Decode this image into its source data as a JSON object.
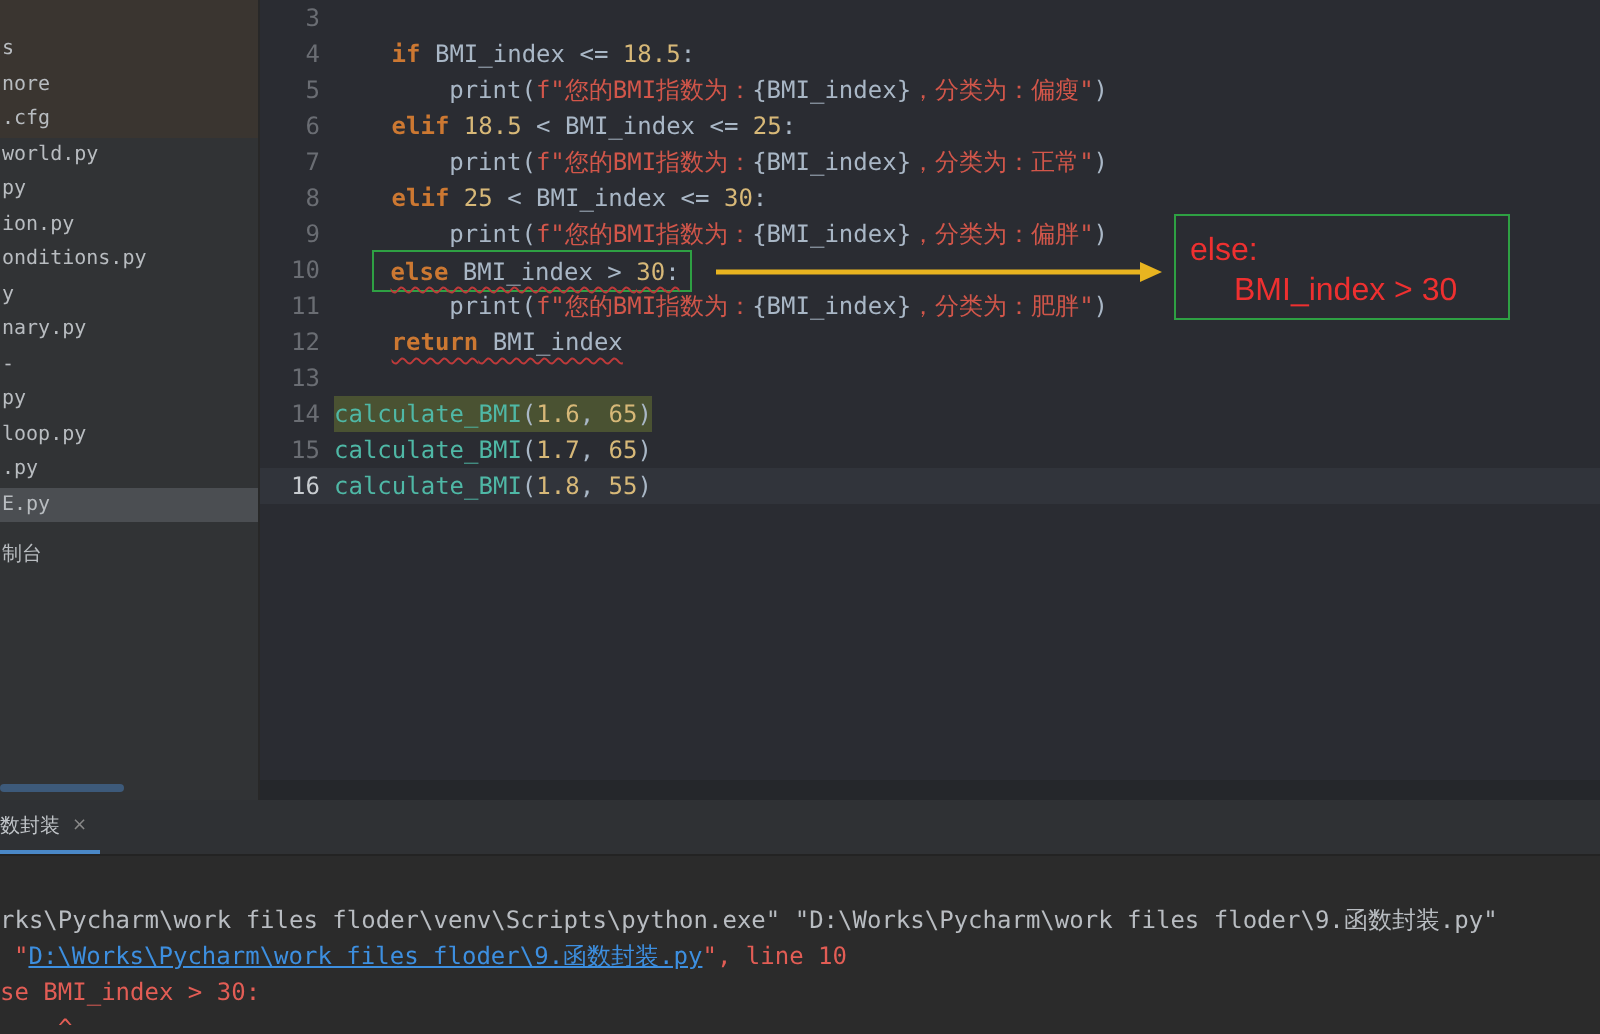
{
  "sidebar": {
    "items": [
      {
        "text": "s",
        "kind": "excluded",
        "selected": false
      },
      {
        "text": "nore",
        "kind": "excluded",
        "selected": false
      },
      {
        "text": ".cfg",
        "kind": "excluded",
        "selected": false
      },
      {
        "text": "world.py",
        "kind": "file",
        "selected": false
      },
      {
        "text": "py",
        "kind": "file",
        "selected": false
      },
      {
        "text": "ion.py",
        "kind": "file",
        "selected": false
      },
      {
        "text": "onditions.py",
        "kind": "file",
        "selected": false
      },
      {
        "text": "y",
        "kind": "file",
        "selected": false
      },
      {
        "text": "nary.py",
        "kind": "file",
        "selected": false
      },
      {
        "text": "-",
        "kind": "file",
        "selected": false
      },
      {
        "text": "py",
        "kind": "file",
        "selected": false
      },
      {
        "text": "loop.py",
        "kind": "file",
        "selected": false
      },
      {
        "text": ".py",
        "kind": "file",
        "selected": false
      },
      {
        "text": "E.py",
        "kind": "file",
        "selected": true
      },
      {
        "text": "制台",
        "kind": "tool",
        "selected": false
      }
    ]
  },
  "editor": {
    "lines": [
      {
        "number": "3",
        "kind": "blank",
        "current": false,
        "error": false,
        "highlighted": false
      },
      {
        "number": "4",
        "kind": "body",
        "current": false,
        "error": false,
        "highlighted": false,
        "tokens": [
          {
            "kind": "kw",
            "text": "if"
          },
          {
            "kind": "plain",
            "text": " BMI_index <= "
          },
          {
            "kind": "num",
            "text": "18.5"
          },
          {
            "kind": "plain",
            "text": ":"
          }
        ]
      },
      {
        "number": "5",
        "kind": "nested",
        "current": false,
        "error": false,
        "highlighted": false,
        "tokens": [
          {
            "kind": "plain",
            "text": "print("
          },
          {
            "kind": "str",
            "text": "f\"您的BMI指数为："
          },
          {
            "kind": "plain",
            "text": "{BMI_index}"
          },
          {
            "kind": "str",
            "text": "，分类为：偏瘦\""
          },
          {
            "kind": "plain",
            "text": ")"
          }
        ]
      },
      {
        "number": "6",
        "kind": "body",
        "current": false,
        "error": false,
        "highlighted": false,
        "tokens": [
          {
            "kind": "kw",
            "text": "elif "
          },
          {
            "kind": "num",
            "text": "18.5"
          },
          {
            "kind": "plain",
            "text": " < BMI_index <= "
          },
          {
            "kind": "num",
            "text": "25"
          },
          {
            "kind": "plain",
            "text": ":"
          }
        ]
      },
      {
        "number": "7",
        "kind": "nested",
        "current": false,
        "error": false,
        "highlighted": false,
        "tokens": [
          {
            "kind": "plain",
            "text": "print("
          },
          {
            "kind": "str",
            "text": "f\"您的BMI指数为："
          },
          {
            "kind": "plain",
            "text": "{BMI_index}"
          },
          {
            "kind": "str",
            "text": "，分类为：正常\""
          },
          {
            "kind": "plain",
            "text": ")"
          }
        ]
      },
      {
        "number": "8",
        "kind": "body",
        "current": false,
        "error": false,
        "highlighted": false,
        "tokens": [
          {
            "kind": "kw",
            "text": "elif "
          },
          {
            "kind": "num",
            "text": "25"
          },
          {
            "kind": "plain",
            "text": " < BMI_index <= "
          },
          {
            "kind": "num",
            "text": "30"
          },
          {
            "kind": "plain",
            "text": ":"
          }
        ]
      },
      {
        "number": "9",
        "kind": "nested",
        "current": false,
        "error": false,
        "highlighted": false,
        "tokens": [
          {
            "kind": "plain",
            "text": "print("
          },
          {
            "kind": "str",
            "text": "f\"您的BMI指数为："
          },
          {
            "kind": "plain",
            "text": "{BMI_index}"
          },
          {
            "kind": "str",
            "text": "，分类为：偏胖\""
          },
          {
            "kind": "plain",
            "text": ")"
          }
        ]
      },
      {
        "number": "10",
        "kind": "body",
        "current": false,
        "error": true,
        "highlighted": false,
        "framed": true,
        "tokens": [
          {
            "kind": "kw",
            "text": "else"
          },
          {
            "kind": "plain",
            "text": " BMI_index > "
          },
          {
            "kind": "num",
            "text": "30"
          },
          {
            "kind": "plain",
            "text": ":"
          }
        ]
      },
      {
        "number": "11",
        "kind": "nested",
        "current": false,
        "error": false,
        "highlighted": false,
        "tokens": [
          {
            "kind": "plain",
            "text": "print("
          },
          {
            "kind": "str",
            "text": "f\"您的BMI指数为："
          },
          {
            "kind": "plain",
            "text": "{BMI_index}"
          },
          {
            "kind": "str",
            "text": "，分类为：肥胖\""
          },
          {
            "kind": "plain",
            "text": ")"
          }
        ]
      },
      {
        "number": "12",
        "kind": "body",
        "current": false,
        "error": true,
        "highlighted": false,
        "tokens": [
          {
            "kind": "kw",
            "text": "return"
          },
          {
            "kind": "plain",
            "text": " BMI_index"
          }
        ]
      },
      {
        "number": "13",
        "kind": "blank",
        "current": false,
        "error": false,
        "highlighted": false
      },
      {
        "number": "14",
        "kind": "top",
        "current": false,
        "error": false,
        "highlighted": true,
        "tokens": [
          {
            "kind": "fn",
            "text": "calculate_BMI"
          },
          {
            "kind": "plain",
            "text": "("
          },
          {
            "kind": "num",
            "text": "1.6"
          },
          {
            "kind": "plain",
            "text": ", "
          },
          {
            "kind": "num",
            "text": "65"
          },
          {
            "kind": "plain",
            "text": ")"
          }
        ]
      },
      {
        "number": "15",
        "kind": "top",
        "current": false,
        "error": false,
        "highlighted": false,
        "tokens": [
          {
            "kind": "fn",
            "text": "calculate_BMI"
          },
          {
            "kind": "plain",
            "text": "("
          },
          {
            "kind": "num",
            "text": "1.7"
          },
          {
            "kind": "plain",
            "text": ", "
          },
          {
            "kind": "num",
            "text": "65"
          },
          {
            "kind": "plain",
            "text": ")"
          }
        ]
      },
      {
        "number": "16",
        "kind": "top",
        "current": true,
        "error": false,
        "highlighted": false,
        "tokens": [
          {
            "kind": "fn",
            "text": "calculate_BMI"
          },
          {
            "kind": "plain",
            "text": "("
          },
          {
            "kind": "num",
            "text": "1.8"
          },
          {
            "kind": "plain",
            "text": ", "
          },
          {
            "kind": "num",
            "text": "55"
          },
          {
            "kind": "plain",
            "text": ")"
          }
        ]
      }
    ],
    "annotation": {
      "lines": [
        "else:",
        "BMI_index > 30"
      ]
    }
  },
  "console": {
    "tab": {
      "label": "数封装",
      "close": "×",
      "selected": true
    },
    "lines": [
      [
        {
          "kind": "plain",
          "text": "rks\\Pycharm\\work files floder\\venv\\Scripts\\python.exe\" \"D:\\Works\\Pycharm\\work files floder\\9.函数封装.py\""
        }
      ],
      [
        {
          "kind": "err",
          "text": "\""
        },
        {
          "kind": "link",
          "text": "D:\\Works\\Pycharm\\work files floder\\9.函数封装.py"
        },
        {
          "kind": "err",
          "text": "\", line 10"
        }
      ],
      [
        {
          "kind": "err",
          "text": "se BMI_index > 30:"
        }
      ],
      [
        {
          "kind": "caret",
          "text": "^"
        }
      ]
    ]
  }
}
